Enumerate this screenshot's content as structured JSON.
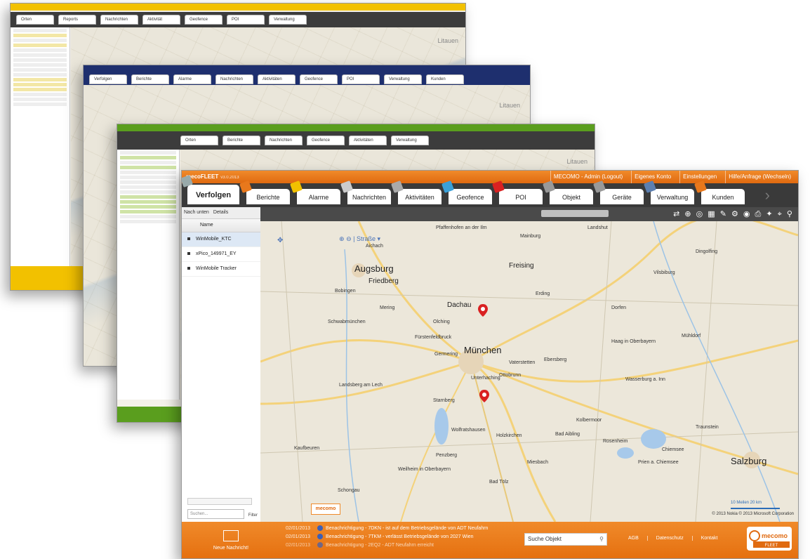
{
  "back_window_1": {
    "tabs": [
      "Orten",
      "Reports",
      "Nachrichten",
      "Aktivität",
      "Geofence",
      "POI",
      "Verwaltung"
    ],
    "map_label": "Litauen"
  },
  "back_window_2": {
    "tabs": [
      "Verfolgen",
      "Berichte",
      "Alarme",
      "Nachrichten",
      "Aktivitäten",
      "Geofence",
      "POI",
      "Verwaltung",
      "Kunden"
    ],
    "map_label": "Litauen"
  },
  "back_window_3": {
    "tabs": [
      "Orten",
      "Berichte",
      "Nachrichten",
      "Geofence",
      "Aktivitäten",
      "Verwaltung"
    ],
    "map_label": "Litauen"
  },
  "main": {
    "brand": "mecoFLEET",
    "version": "v3.0.2013",
    "top_links": [
      "MECOMO - Admin (Logout)",
      "Eigenes Konto",
      "Einstellungen",
      "Hilfe/Anfrage (Wechseln)"
    ],
    "tabs": [
      {
        "label": "Verfolgen",
        "icon": "pen-icon",
        "active": true
      },
      {
        "label": "Berichte",
        "icon": "report-icon"
      },
      {
        "label": "Alarme",
        "icon": "warning-icon"
      },
      {
        "label": "Nachrichten",
        "icon": "envelope-icon"
      },
      {
        "label": "Aktivitäten",
        "icon": "activity-icon"
      },
      {
        "label": "Geofence",
        "icon": "flag-icon"
      },
      {
        "label": "POI",
        "icon": "pin-icon"
      },
      {
        "label": "Objekt",
        "icon": "object-icon"
      },
      {
        "label": "Geräte",
        "icon": "device-icon"
      },
      {
        "label": "Verwaltung",
        "icon": "tools-icon"
      },
      {
        "label": "Kunden",
        "icon": "person-icon"
      }
    ],
    "sidebar": {
      "toolbar": [
        "Nach unten",
        "Details"
      ],
      "column_header": "Name",
      "items": [
        "WinMobile_KTC",
        "xPico_149971_EY",
        "WinMobile Tracker"
      ],
      "search_placeholder": "Suchen...",
      "filter_label": "Filter"
    },
    "map": {
      "layer_label": "Straße",
      "places": {
        "augsburg": "Augsburg",
        "muenchen": "München",
        "friedberg": "Friedberg",
        "dachau": "Dachau",
        "freising": "Freising",
        "erding": "Erding",
        "salzburg": "Salzburg",
        "rosenheim": "Rosenheim",
        "starnberg": "Starnberg",
        "landsberg": "Landsberg am Lech",
        "wolfratshausen": "Wolfratshausen",
        "holzkirchen": "Holzkirchen",
        "ebersberg": "Ebersberg",
        "vaterstetten": "Vaterstetten",
        "germering": "Germering",
        "fuerstenfeldbruck": "Fürstenfeldbruck",
        "pfaffenhofen": "Pfaffenhofen an der Ilm",
        "landshut": "Landshut",
        "mainburg": "Mainburg",
        "aichach": "Aichach",
        "kaufbeuren": "Kaufbeuren",
        "weilheim": "Weilheim in Oberbayern",
        "bad_toelz": "Bad Tölz",
        "traunstein": "Traunstein",
        "wasserburg": "Wasserburg a. Inn",
        "muehldorf": "Mühldorf",
        "dingolfing": "Dingolfing",
        "vilsbiburg": "Vilsbiburg",
        "dorfen": "Dorfen",
        "haag": "Haag in Oberbayern",
        "prien": "Prien a. Chiemsee",
        "chiemsee": "Chiemsee",
        "kolbermoor": "Kolbermoor",
        "bad_aibling": "Bad Aibling",
        "miesbach": "Miesbach",
        "penzberg": "Penzberg",
        "schongau": "Schongau",
        "bobingen": "Bobingen",
        "schwabmuenchen": "Schwabmünchen",
        "mering": "Mering",
        "olching": "Olching",
        "unterhaching": "Unterhaching",
        "ottobrunn": "Ottobrunn"
      },
      "copyright": "© 2013 Nokia  © 2013 Microsoft Corporation",
      "scale": "10 Meilen  20 km",
      "brand_mark": "mecomo"
    },
    "footer": {
      "new_message": "Neue Nachricht!",
      "notifications": [
        {
          "date": "02/01/2013",
          "text": "Benachrichtigung - 7DKN - ist auf dem Betriebsgelände von ADT Neufahrn"
        },
        {
          "date": "02/01/2013",
          "text": "Benachrichtigung - 7TKM - verlässt Betriebsgelände von 2027 Wien"
        },
        {
          "date": "02/01/2013",
          "text": "Benachrichtigung - 2EQ2 - ADT Neufahrn erreicht"
        }
      ],
      "search_placeholder": "Suche Objekt",
      "links": [
        "AGB",
        "Datenschutz",
        "Kontakt"
      ],
      "logo_top": "mecomo",
      "logo_bottom": "FLEET"
    }
  },
  "colors": {
    "orange": "#E8781C",
    "yellow": "#F2C100",
    "navy": "#1E2F6E",
    "green": "#5A9E1E",
    "pin_red": "#D92121"
  }
}
